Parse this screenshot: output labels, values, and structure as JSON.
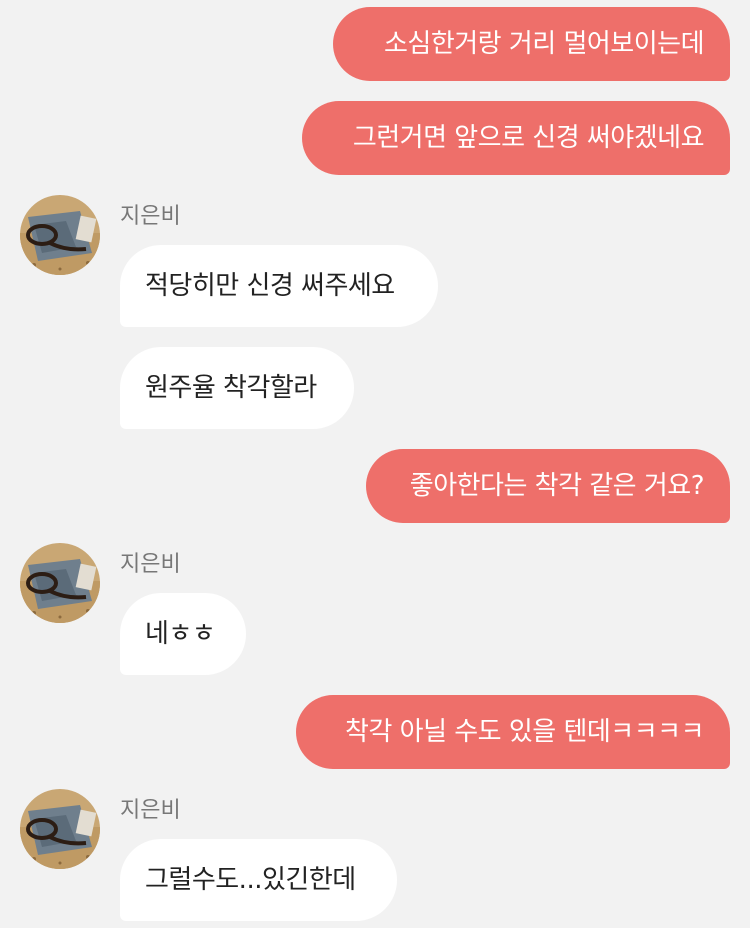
{
  "colors": {
    "background": "#f2f2f2",
    "sent_bubble": "#ee6f6a",
    "received_bubble": "#ffffff",
    "sender_name": "#777777"
  },
  "messages": [
    {
      "direction": "sent",
      "text": "소심한거랑 거리 멀어보이는데"
    },
    {
      "direction": "sent",
      "text": "그런거면 앞으로 신경 써야겠네요"
    },
    {
      "direction": "received",
      "sender": "지은비",
      "text": "적당히만 신경 써주세요"
    },
    {
      "direction": "received",
      "text": "원주율 착각할라"
    },
    {
      "direction": "sent",
      "text": "좋아한다는 착각 같은 거요?"
    },
    {
      "direction": "received",
      "sender": "지은비",
      "text": "네ㅎㅎ"
    },
    {
      "direction": "sent",
      "text": "착각 아닐 수도 있을 텐데ㅋㅋㅋㅋ"
    },
    {
      "direction": "received",
      "sender": "지은비",
      "text": "그럴수도...있긴한데"
    }
  ]
}
